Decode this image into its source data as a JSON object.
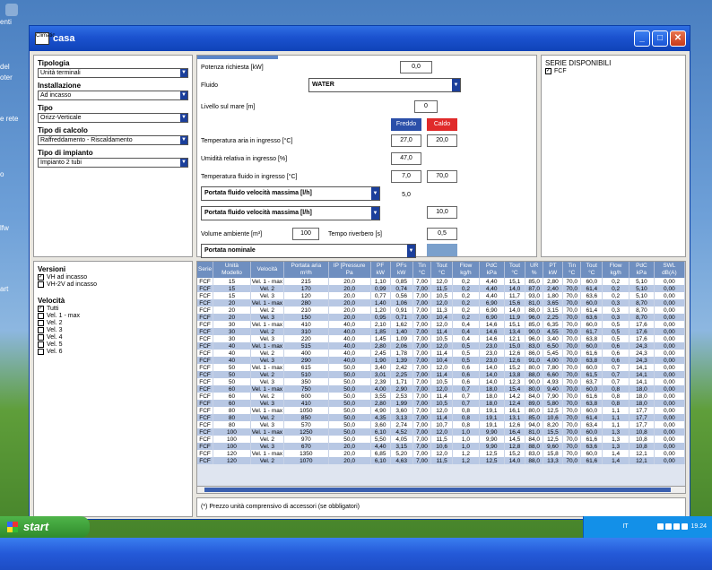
{
  "desktop": {
    "icons": [
      "enti",
      "del",
      "oter",
      "e rete",
      "o",
      "lfw",
      "art"
    ]
  },
  "window": {
    "title": "casa",
    "app_icon": "Climatic"
  },
  "left": {
    "tipologia": {
      "label": "Tipologia",
      "value": "Unità terminali"
    },
    "installazione": {
      "label": "Installazione",
      "value": "Ad incasso"
    },
    "tipo": {
      "label": "Tipo",
      "value": "Orizz-Verticale"
    },
    "tipo_calcolo": {
      "label": "Tipo di calcolo",
      "value": "Raffreddamento - Riscaldamento"
    },
    "tipo_impianto": {
      "label": "Tipo di impianto",
      "value": "Impianto 2 tubi"
    }
  },
  "params": {
    "potenza_label": "Potenza richiesta [kW]",
    "potenza_value": "0,0",
    "fluido_label": "Fluido",
    "fluido_value": "WATER",
    "livello_label": "Livello sul mare [m]",
    "livello_value": "0",
    "freddo": "Freddo",
    "caldo": "Caldo",
    "temp_aria_label": "Temperatura aria in ingresso [°C]",
    "temp_aria_f": "27,0",
    "temp_aria_c": "20,0",
    "umidita_label": "Umidità relativa in ingresso [%]",
    "umidita_value": "47,0",
    "temp_fluido_label": "Temperatura fluido in ingresso [°C]",
    "temp_fluido_f": "7,0",
    "temp_fluido_c": "70,0",
    "portata1_label": "Portata fluido velocità massima [l/h]",
    "portata1_value": "5,0",
    "portata2_label": "Portata fluido velocità massima [l/h]",
    "portata2_value": "10,0",
    "volume_label": "Volume ambiente [m³]",
    "volume_value": "100",
    "tempo_label": "Tempo riverbero [s]",
    "tempo_value": "0,5",
    "portata_nominale": "Portata nominale"
  },
  "serie": {
    "title": "SERIE DISPONIBILI",
    "item": "FCF"
  },
  "versioni": {
    "title": "Versioni",
    "items": [
      {
        "label": "VH ad incasso",
        "checked": true
      },
      {
        "label": "VH-2V ad incasso",
        "checked": false
      }
    ]
  },
  "velocita": {
    "title": "Velocità",
    "items": [
      {
        "label": "Tutti",
        "checked": true
      },
      {
        "label": "Vel. 1 - max",
        "checked": false
      },
      {
        "label": "Vel. 2",
        "checked": false
      },
      {
        "label": "Vel. 3",
        "checked": false
      },
      {
        "label": "Vel. 4",
        "checked": false
      },
      {
        "label": "Vel. 5",
        "checked": false
      },
      {
        "label": "Vel. 6",
        "checked": false
      }
    ]
  },
  "table": {
    "headers": [
      "Serie",
      "Unità Modello",
      "Velocità",
      "Portata aria m³/h",
      "IP [Pressure Pa",
      "PF kW",
      "PFs kW",
      "Tin °C",
      "Tout °C",
      "Flow kg/h",
      "PdC kPa",
      "Tout °C",
      "UR %",
      "PT kW",
      "Tin °C",
      "Tout °C",
      "Flow kg/h",
      "PdC kPa",
      "SWL dB(A)"
    ],
    "rows": [
      [
        "FCF",
        "15",
        "Vel. 1 - max",
        "215",
        "20,0",
        "1,10",
        "0,85",
        "7,00",
        "12,0",
        "0,2",
        "4,40",
        "15,1",
        "85,0",
        "2,80",
        "70,0",
        "60,0",
        "0,2",
        "5,10",
        "0,00"
      ],
      [
        "FCF",
        "15",
        "Vel. 2",
        "170",
        "20,0",
        "0,99",
        "0,74",
        "7,00",
        "11,5",
        "0,2",
        "4,40",
        "14,0",
        "87,0",
        "2,40",
        "70,0",
        "61,4",
        "0,2",
        "5,10",
        "0,00"
      ],
      [
        "FCF",
        "15",
        "Vel. 3",
        "120",
        "20,0",
        "0,77",
        "0,56",
        "7,00",
        "10,5",
        "0,2",
        "4,40",
        "11,7",
        "93,0",
        "1,80",
        "70,0",
        "63,6",
        "0,2",
        "5,10",
        "0,00"
      ],
      [
        "FCF",
        "20",
        "Vel. 1 - max",
        "280",
        "20,0",
        "1,40",
        "1,06",
        "7,00",
        "12,0",
        "0,2",
        "6,90",
        "15,6",
        "81,0",
        "3,65",
        "70,0",
        "60,0",
        "0,3",
        "8,70",
        "0,00"
      ],
      [
        "FCF",
        "20",
        "Vel. 2",
        "210",
        "20,0",
        "1,20",
        "0,91",
        "7,00",
        "11,3",
        "0,2",
        "6,90",
        "14,0",
        "88,0",
        "3,15",
        "70,0",
        "61,4",
        "0,3",
        "8,70",
        "0,00"
      ],
      [
        "FCF",
        "20",
        "Vel. 3",
        "150",
        "20,0",
        "0,95",
        "0,71",
        "7,00",
        "10,4",
        "0,2",
        "6,90",
        "11,9",
        "96,0",
        "2,25",
        "70,0",
        "63,6",
        "0,3",
        "8,70",
        "0,00"
      ],
      [
        "FCF",
        "30",
        "Vel. 1 - max",
        "410",
        "40,0",
        "2,10",
        "1,62",
        "7,00",
        "12,0",
        "0,4",
        "14,6",
        "15,1",
        "85,0",
        "6,35",
        "70,0",
        "60,0",
        "0,5",
        "17,6",
        "0,00"
      ],
      [
        "FCF",
        "30",
        "Vel. 2",
        "310",
        "40,0",
        "1,85",
        "1,40",
        "7,00",
        "11,4",
        "0,4",
        "14,6",
        "13,4",
        "90,0",
        "4,55",
        "70,0",
        "61,7",
        "0,5",
        "17,6",
        "0,00"
      ],
      [
        "FCF",
        "30",
        "Vel. 3",
        "220",
        "40,0",
        "1,45",
        "1,09",
        "7,00",
        "10,5",
        "0,4",
        "14,6",
        "12,1",
        "96,0",
        "3,40",
        "70,0",
        "63,8",
        "0,5",
        "17,6",
        "0,00"
      ],
      [
        "FCF",
        "40",
        "Vel. 1 - max",
        "515",
        "40,0",
        "2,80",
        "2,06",
        "7,00",
        "12,0",
        "0,5",
        "23,0",
        "15,0",
        "83,0",
        "6,50",
        "70,0",
        "60,0",
        "0,6",
        "24,3",
        "0,00"
      ],
      [
        "FCF",
        "40",
        "Vel. 2",
        "400",
        "40,0",
        "2,45",
        "1,78",
        "7,00",
        "11,4",
        "0,5",
        "23,0",
        "12,6",
        "86,0",
        "5,45",
        "70,0",
        "61,6",
        "0,6",
        "24,3",
        "0,00"
      ],
      [
        "FCF",
        "40",
        "Vel. 3",
        "290",
        "40,0",
        "1,90",
        "1,39",
        "7,00",
        "10,4",
        "0,5",
        "23,0",
        "12,6",
        "91,0",
        "4,00",
        "70,0",
        "63,8",
        "0,6",
        "24,3",
        "0,00"
      ],
      [
        "FCF",
        "50",
        "Vel. 1 - max",
        "615",
        "50,0",
        "3,40",
        "2,42",
        "7,00",
        "12,0",
        "0,6",
        "14,0",
        "15,2",
        "80,0",
        "7,80",
        "70,0",
        "60,0",
        "0,7",
        "14,1",
        "0,00"
      ],
      [
        "FCF",
        "50",
        "Vel. 2",
        "510",
        "50,0",
        "3,01",
        "2,25",
        "7,00",
        "11,4",
        "0,6",
        "14,0",
        "13,8",
        "88,0",
        "6,60",
        "70,0",
        "61,5",
        "0,7",
        "14,1",
        "0,00"
      ],
      [
        "FCF",
        "50",
        "Vel. 3",
        "350",
        "50,0",
        "2,39",
        "1,71",
        "7,00",
        "10,5",
        "0,6",
        "14,0",
        "12,3",
        "90,0",
        "4,93",
        "70,0",
        "63,7",
        "0,7",
        "14,1",
        "0,00"
      ],
      [
        "FCF",
        "60",
        "Vel. 1 - max",
        "750",
        "50,0",
        "4,00",
        "2,90",
        "7,00",
        "12,0",
        "0,7",
        "18,0",
        "15,4",
        "80,0",
        "9,40",
        "70,0",
        "60,0",
        "0,8",
        "18,0",
        "0,00"
      ],
      [
        "FCF",
        "60",
        "Vel. 2",
        "600",
        "50,0",
        "3,55",
        "2,53",
        "7,00",
        "11,4",
        "0,7",
        "18,0",
        "14,2",
        "84,0",
        "7,90",
        "70,0",
        "61,6",
        "0,8",
        "18,0",
        "0,00"
      ],
      [
        "FCF",
        "60",
        "Vel. 3",
        "410",
        "50,0",
        "2,80",
        "1,99",
        "7,00",
        "10,5",
        "0,7",
        "18,0",
        "12,4",
        "89,0",
        "5,80",
        "70,0",
        "63,8",
        "0,8",
        "18,0",
        "0,00"
      ],
      [
        "FCF",
        "80",
        "Vel. 1 - max",
        "1050",
        "50,0",
        "4,90",
        "3,60",
        "7,00",
        "12,0",
        "0,8",
        "19,1",
        "16,1",
        "80,0",
        "12,5",
        "70,0",
        "60,0",
        "1,1",
        "17,7",
        "0,00"
      ],
      [
        "FCF",
        "80",
        "Vel. 2",
        "850",
        "50,0",
        "4,35",
        "3,13",
        "7,00",
        "11,4",
        "0,8",
        "19,1",
        "13,1",
        "85,0",
        "10,6",
        "70,0",
        "61,4",
        "1,1",
        "17,7",
        "0,00"
      ],
      [
        "FCF",
        "80",
        "Vel. 3",
        "570",
        "50,0",
        "3,60",
        "2,74",
        "7,00",
        "10,7",
        "0,8",
        "19,1",
        "12,6",
        "94,0",
        "8,20",
        "70,0",
        "63,4",
        "1,1",
        "17,7",
        "0,00"
      ],
      [
        "FCF",
        "100",
        "Vel. 1 - max",
        "1250",
        "50,0",
        "6,10",
        "4,52",
        "7,00",
        "12,0",
        "1,0",
        "9,90",
        "16,4",
        "81,0",
        "15,5",
        "70,0",
        "60,0",
        "1,3",
        "10,8",
        "0,00"
      ],
      [
        "FCF",
        "100",
        "Vel. 2",
        "970",
        "50,0",
        "5,50",
        "4,05",
        "7,00",
        "11,5",
        "1,0",
        "9,90",
        "14,5",
        "84,0",
        "12,5",
        "70,0",
        "61,6",
        "1,3",
        "10,8",
        "0,00"
      ],
      [
        "FCF",
        "100",
        "Vel. 3",
        "670",
        "20,0",
        "4,40",
        "3,15",
        "7,00",
        "10,6",
        "1,0",
        "9,90",
        "12,8",
        "88,0",
        "9,60",
        "70,0",
        "63,6",
        "1,3",
        "10,8",
        "0,00"
      ],
      [
        "FCF",
        "120",
        "Vel. 1 - max",
        "1350",
        "20,0",
        "6,85",
        "5,20",
        "7,00",
        "12,0",
        "1,2",
        "12,5",
        "15,2",
        "83,0",
        "15,8",
        "70,0",
        "60,0",
        "1,4",
        "12,1",
        "0,00"
      ],
      [
        "FCF",
        "120",
        "Vel. 2",
        "1070",
        "20,0",
        "6,10",
        "4,63",
        "7,00",
        "11,5",
        "1,2",
        "12,5",
        "14,0",
        "88,0",
        "13,3",
        "70,0",
        "61,6",
        "1,4",
        "12,1",
        "0,00"
      ]
    ]
  },
  "footnote": "(*) Prezzo unità comprensivo di accessori (se obbligatori)",
  "taskbar": {
    "start": "start",
    "clock": "19.24",
    "tray_text": "IT"
  }
}
